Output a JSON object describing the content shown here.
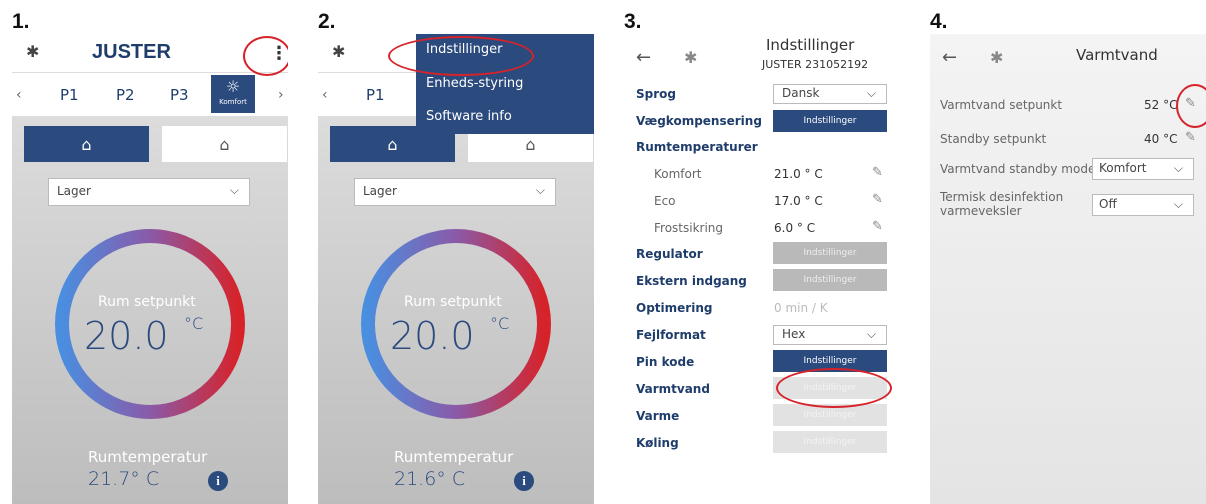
{
  "steps": [
    "1.",
    "2.",
    "3.",
    "4."
  ],
  "main_screen": {
    "title": "JUSTER",
    "bt_icon": "bluetooth-icon",
    "more_icon": "kebab-menu-icon",
    "profiles": [
      "P1",
      "P2",
      "P3"
    ],
    "active_profile": "Komfort",
    "mode_select": "Lager",
    "setpoint_label": "Rum setpunkt",
    "setpoint_value": "20.0",
    "setpoint_unit": "°C",
    "room_temp_label": "Rumtemperatur",
    "room_temp_1": "21.7° C",
    "room_temp_2": "21.6° C",
    "info_icon": "i"
  },
  "menu": {
    "items": [
      "Indstillinger",
      "Enheds-styring",
      "Software info"
    ]
  },
  "settings": {
    "title": "Indstillinger",
    "subtitle": "JUSTER 231052192",
    "rows": {
      "sprog": {
        "label": "Sprog",
        "value": "Dansk"
      },
      "vaegkomp": {
        "label": "Vægkompensering",
        "button": "Indstillinger"
      },
      "rumtemp": {
        "label": "Rumtemperaturer"
      },
      "komfort": {
        "label": "Komfort",
        "value": "21.0 ° C"
      },
      "eco": {
        "label": "Eco",
        "value": "17.0 ° C"
      },
      "frost": {
        "label": "Frostsikring",
        "value": "6.0 ° C"
      },
      "regulator": {
        "label": "Regulator",
        "button": "Indstillinger"
      },
      "ekstern": {
        "label": "Ekstern indgang",
        "button": "Indstillinger"
      },
      "optim": {
        "label": "Optimering",
        "value": "0 min / K"
      },
      "fejl": {
        "label": "Fejlformat",
        "value": "Hex"
      },
      "pin": {
        "label": "Pin kode",
        "button": "Indstillinger"
      },
      "varmtvand": {
        "label": "Varmtvand",
        "button": "Indstillinger"
      },
      "varme": {
        "label": "Varme",
        "button": "Indstillinger"
      },
      "koling": {
        "label": "Køling",
        "button": "Indstillinger"
      }
    }
  },
  "varmtvand": {
    "title": "Varmtvand",
    "setpunkt": {
      "label": "Varmtvand setpunkt",
      "value": "52 °C"
    },
    "standby": {
      "label": "Standby setpunkt",
      "value": "40 °C"
    },
    "standby_mode": {
      "label": "Varmtvand standby mode",
      "value": "Komfort"
    },
    "termisk": {
      "label_1": "Termisk desinfektion",
      "label_2": "varmeveksler",
      "value": "Off"
    }
  },
  "colors": {
    "accent": "#2b4a7e",
    "highlight": "#d6232a"
  }
}
